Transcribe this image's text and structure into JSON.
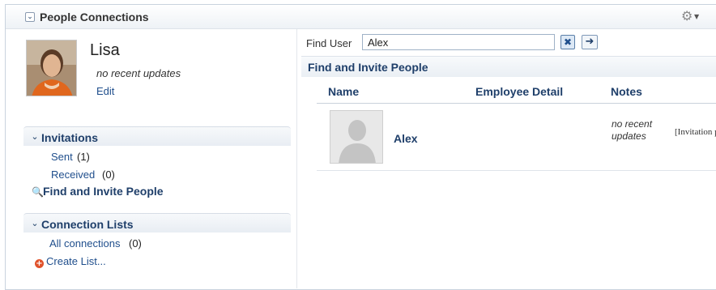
{
  "header": {
    "title": "People Connections",
    "collapse_icon": "chevron-down-icon",
    "settings_icon": "gear-icon"
  },
  "profile": {
    "name": "Lisa",
    "status": "no recent updates",
    "edit_label": "Edit"
  },
  "invitations": {
    "title": "Invitations",
    "sent_label": "Sent",
    "sent_count": "(1)",
    "received_label": "Received",
    "received_count": "(0)",
    "find_label": "Find and Invite People"
  },
  "connection_lists": {
    "title": "Connection Lists",
    "all_label": "All connections",
    "all_count": "(0)",
    "create_label": "Create List..."
  },
  "search": {
    "label": "Find User",
    "value": "Alex",
    "clear_icon": "clear-icon",
    "go_icon": "arrow-right-icon"
  },
  "results": {
    "title": "Find and Invite People",
    "columns": [
      "Name",
      "Employee Detail",
      "Notes"
    ],
    "rows": [
      {
        "name": "Alex",
        "notes": "no recent updates",
        "action": "[Invitation pending]"
      }
    ]
  },
  "colors": {
    "link": "#1f4e8c",
    "heading": "#1f3f6a",
    "border": "#c9d3de"
  }
}
